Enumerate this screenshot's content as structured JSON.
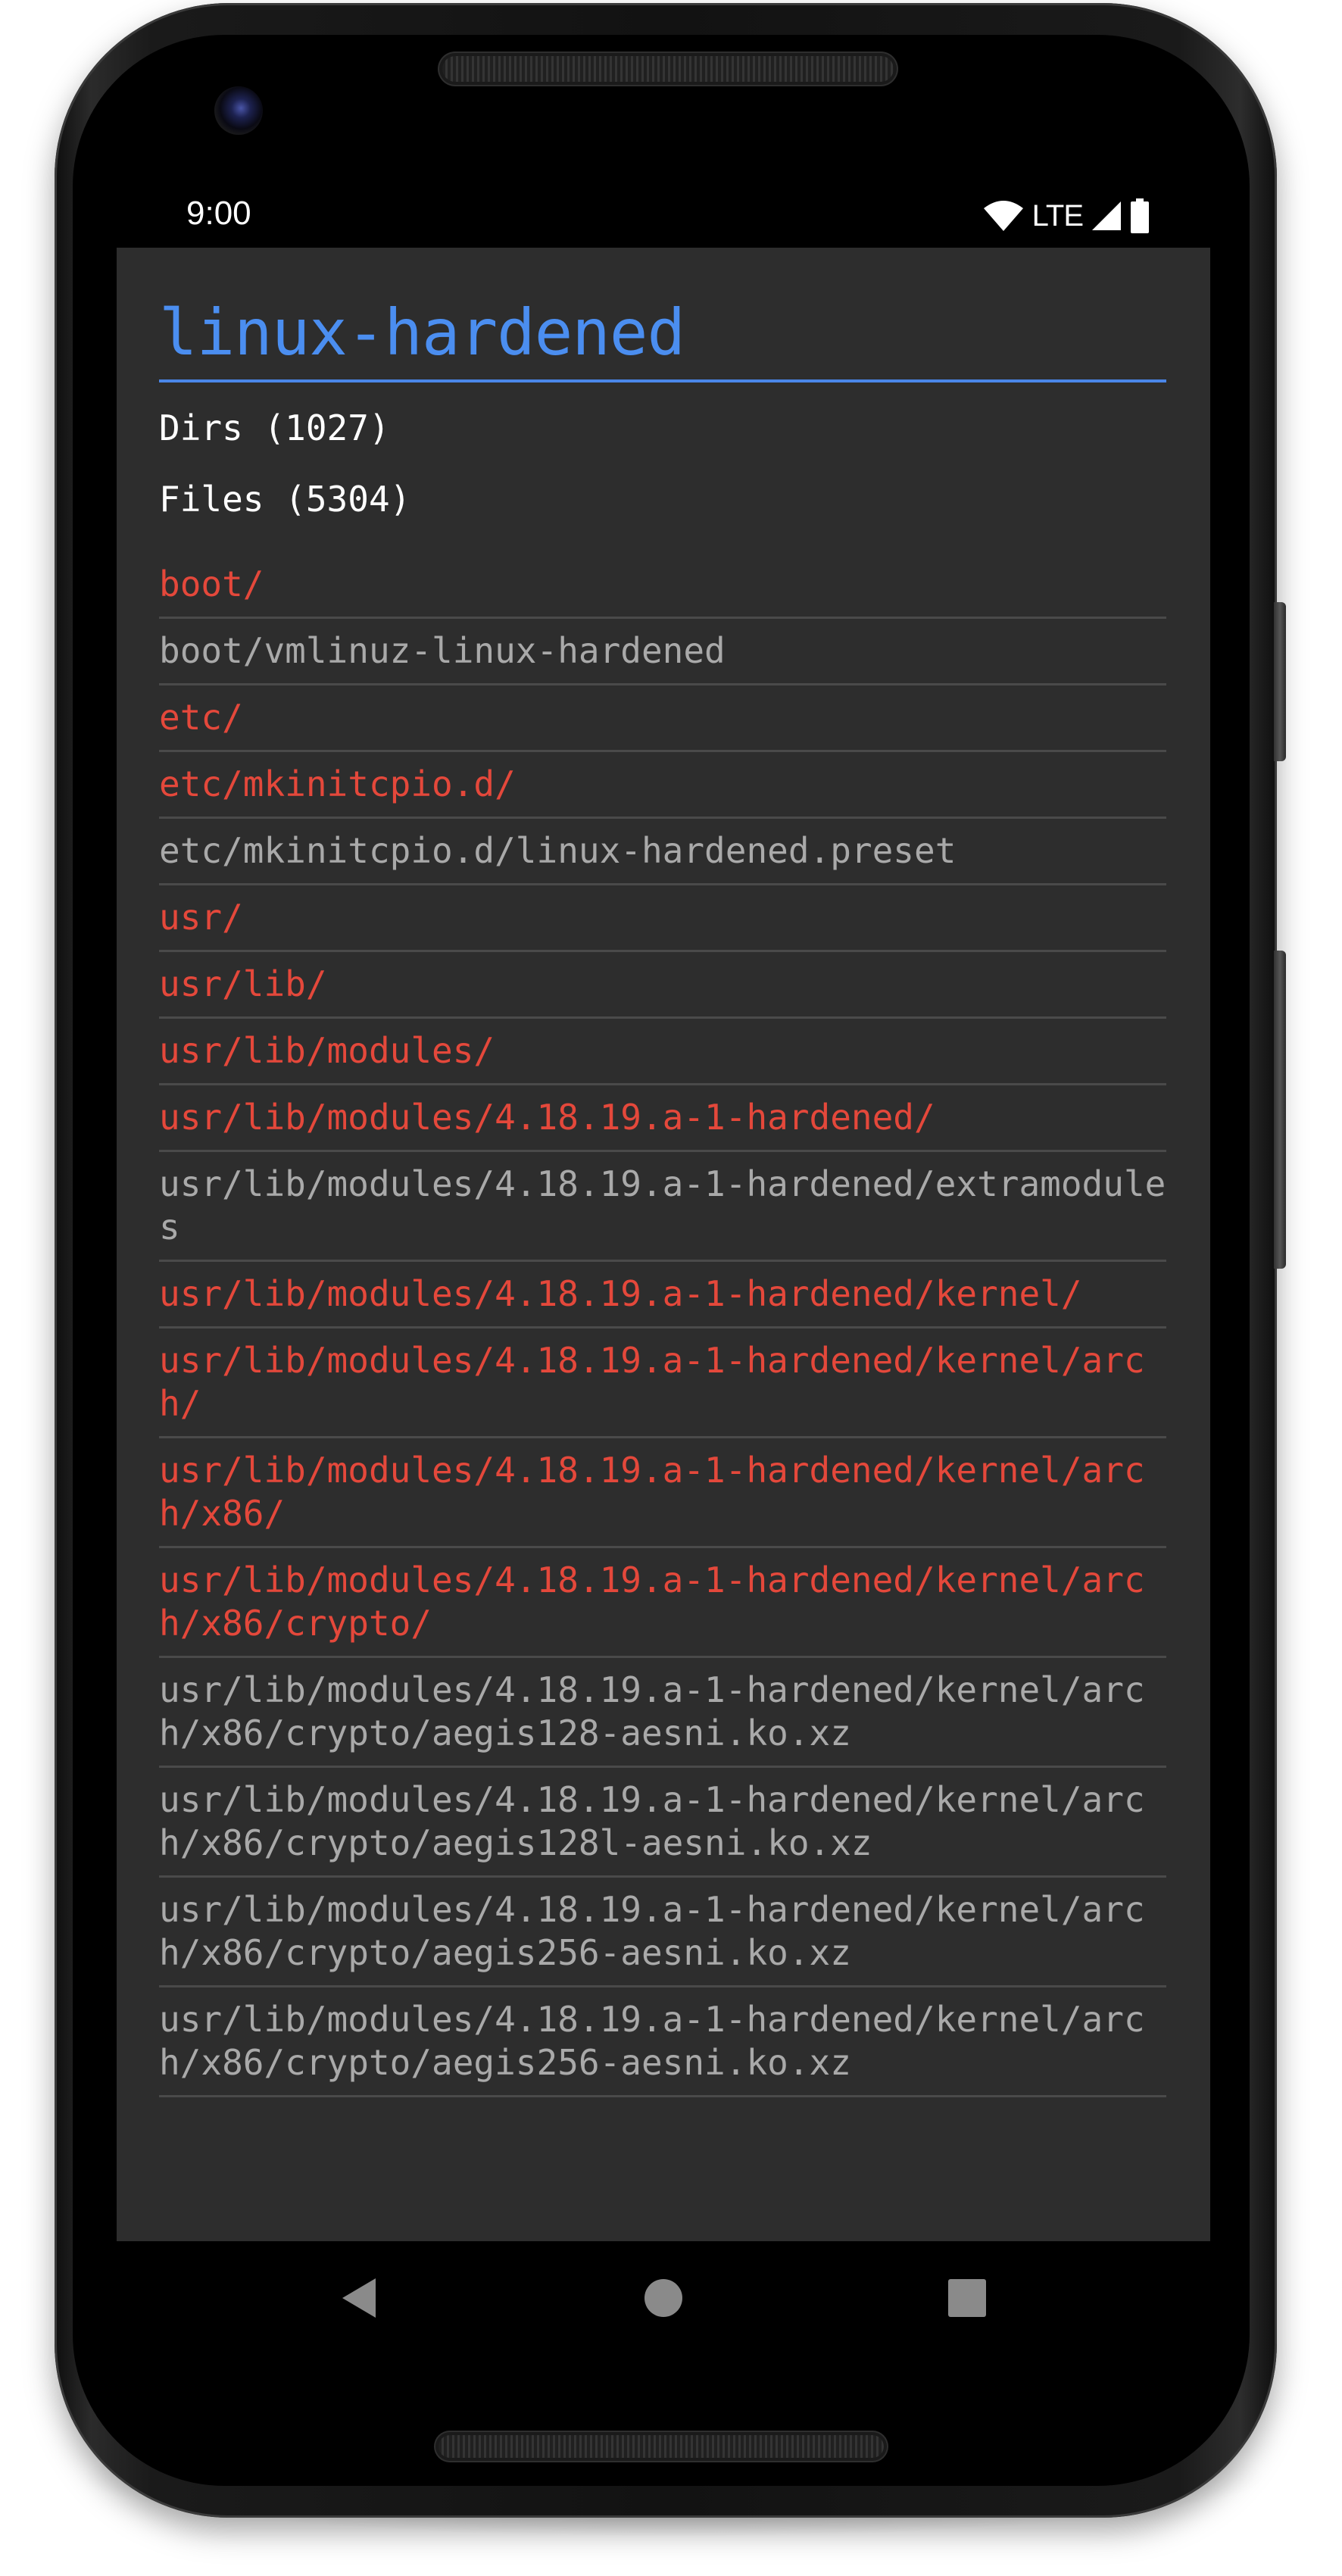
{
  "status_bar": {
    "time": "9:00",
    "network": "LTE",
    "icons": [
      "wifi-icon",
      "signal-icon",
      "battery-icon"
    ]
  },
  "app": {
    "title": "linux-hardened",
    "dirs_label": "Dirs (1027)",
    "files_label": "Files (5304)",
    "colors": {
      "background": "#2d2d2d",
      "title": "#4b8ef0",
      "directory": "#e4483b",
      "file": "#a9a9a9",
      "divider": "#4a4a4a"
    },
    "entries": [
      {
        "path": "boot/",
        "type": "dir"
      },
      {
        "path": "boot/vmlinuz-linux-hardened",
        "type": "file"
      },
      {
        "path": "etc/",
        "type": "dir"
      },
      {
        "path": "etc/mkinitcpio.d/",
        "type": "dir"
      },
      {
        "path": "etc/mkinitcpio.d/linux-hardened.preset",
        "type": "file"
      },
      {
        "path": "usr/",
        "type": "dir"
      },
      {
        "path": "usr/lib/",
        "type": "dir"
      },
      {
        "path": "usr/lib/modules/",
        "type": "dir"
      },
      {
        "path": "usr/lib/modules/4.18.19.a-1-hardened/",
        "type": "dir"
      },
      {
        "path": "usr/lib/modules/4.18.19.a-1-hardened/extramodules",
        "type": "file"
      },
      {
        "path": "usr/lib/modules/4.18.19.a-1-hardened/kernel/",
        "type": "dir"
      },
      {
        "path": "usr/lib/modules/4.18.19.a-1-hardened/kernel/arch/",
        "type": "dir"
      },
      {
        "path": "usr/lib/modules/4.18.19.a-1-hardened/kernel/arch/x86/",
        "type": "dir"
      },
      {
        "path": "usr/lib/modules/4.18.19.a-1-hardened/kernel/arch/x86/crypto/",
        "type": "dir"
      },
      {
        "path": "usr/lib/modules/4.18.19.a-1-hardened/kernel/arch/x86/crypto/aegis128-aesni.ko.xz",
        "type": "file"
      },
      {
        "path": "usr/lib/modules/4.18.19.a-1-hardened/kernel/arch/x86/crypto/aegis128l-aesni.ko.xz",
        "type": "file"
      },
      {
        "path": "usr/lib/modules/4.18.19.a-1-hardened/kernel/arch/x86/crypto/aegis256-aesni.ko.xz",
        "type": "file"
      },
      {
        "path": "usr/lib/modules/4.18.19.a-1-hardened/kernel/arch/x86/crypto/aegis256-aesni.ko.xz",
        "type": "file"
      }
    ]
  },
  "nav_bar": {
    "buttons": [
      "back-icon",
      "home-icon",
      "recents-icon"
    ]
  }
}
